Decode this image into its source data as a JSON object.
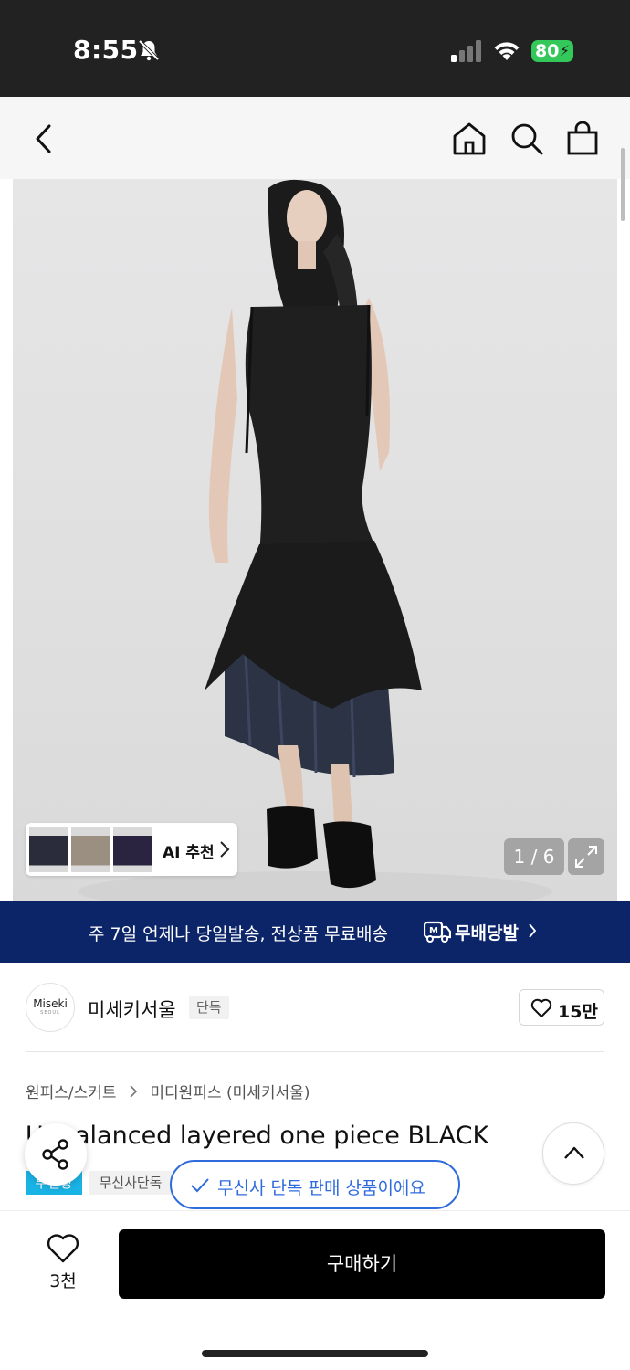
{
  "status_bar": {
    "time": "8:55",
    "battery": "80",
    "icons": [
      "bell-slash-icon",
      "signal-icon",
      "wifi-icon",
      "battery-icon"
    ]
  },
  "header": {
    "icons": [
      "back-icon",
      "home-icon",
      "search-icon",
      "shopping-bag-icon"
    ]
  },
  "gallery": {
    "ai_label": "AI 추천",
    "page_counter": "1 / 6",
    "thumb_colors": [
      "#2a2c3c",
      "#9a8f80",
      "#2a2440"
    ]
  },
  "banner": {
    "text": "주 7일 언제나 당일발송, 전상품 무료배송",
    "brand": "무배당발",
    "background": "#0c2569"
  },
  "brand": {
    "logo_text": "Miseki",
    "logo_sub": "SEOUL",
    "name": "미세키서울",
    "tag": "단독",
    "likes": "15만"
  },
  "product": {
    "breadcrumb": [
      "원피스/스커트",
      "미디원피스 (미세키서울)"
    ],
    "title": "Unbalanced layered one piece BLACK",
    "tags": [
      "무진장",
      "무신사단독"
    ]
  },
  "toast": {
    "text": "무신사 단독 판매 상품이에요",
    "color": "#2f6bdc"
  },
  "bottom_bar": {
    "wish_count": "3천",
    "buy_label": "구매하기"
  }
}
